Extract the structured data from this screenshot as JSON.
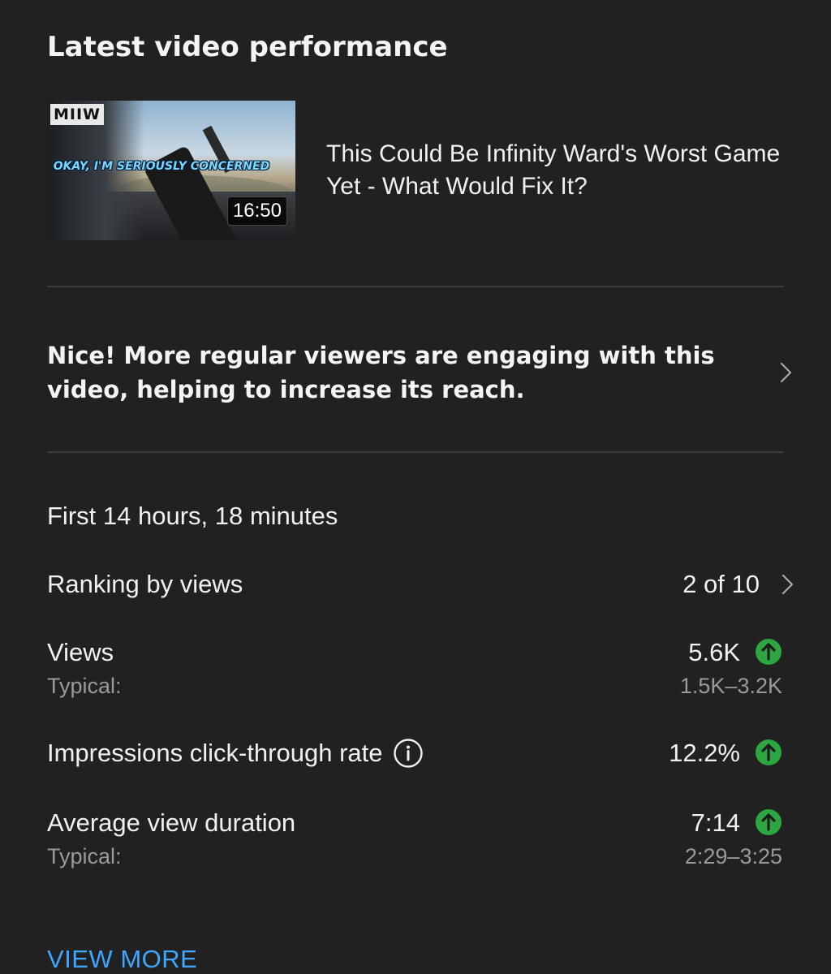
{
  "card": {
    "title": "Latest video performance"
  },
  "video": {
    "title": "This Could Be Infinity Ward's Worst Game Yet - What Would Fix It?",
    "duration": "16:50",
    "thumbnail_logo": "MIIW",
    "thumbnail_text": "OKAY, I'M SERIOUSLY CONCERNED"
  },
  "insight": {
    "text": "Nice! More regular viewers are engaging with this video, helping to increase its reach.",
    "icon": "chevron-right-icon"
  },
  "period": {
    "label": "First 14 hours, 18 minutes"
  },
  "ranking": {
    "label": "Ranking by views",
    "value": "2 of 10",
    "icon": "chevron-right-icon"
  },
  "metrics": {
    "views": {
      "label": "Views",
      "value": "5.6K",
      "typical_label": "Typical:",
      "typical_range": "1.5K–3.2K",
      "trend_icon": "arrow-up-circle-icon"
    },
    "ctr": {
      "label": "Impressions click-through rate",
      "value": "12.2%",
      "info_icon": "info-icon",
      "trend_icon": "arrow-up-circle-icon"
    },
    "avd": {
      "label": "Average view duration",
      "value": "7:14",
      "typical_label": "Typical:",
      "typical_range": "2:29–3:25",
      "trend_icon": "arrow-up-circle-icon"
    }
  },
  "view_more": {
    "label": "VIEW MORE"
  },
  "colors": {
    "background": "#212121",
    "divider": "#3c3c3c",
    "text_primary": "#f1f1f1",
    "text_secondary": "#9a9a9a",
    "accent_link": "#3ea6ff",
    "trend_up": "#2ba640"
  }
}
